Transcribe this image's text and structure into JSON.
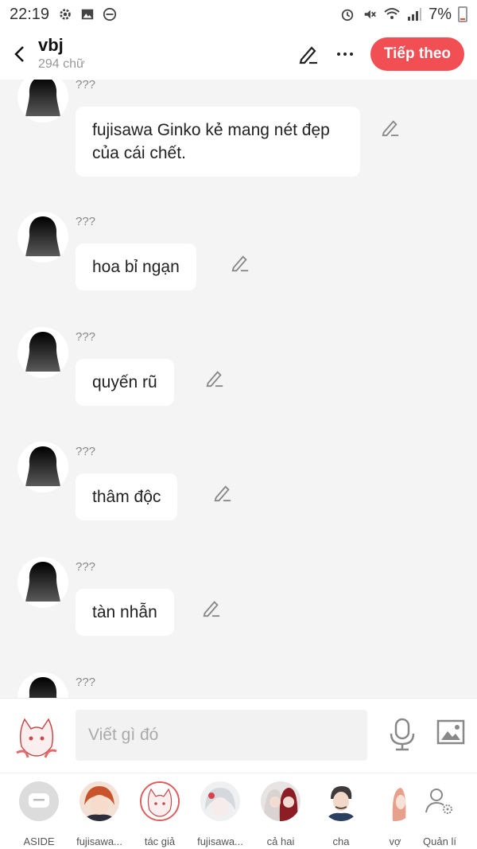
{
  "status_bar": {
    "time": "22:19",
    "battery": "7%"
  },
  "header": {
    "title": "vbj",
    "subtitle": "294 chữ",
    "next_label": "Tiếp theo"
  },
  "messages": [
    {
      "sender": "???",
      "text": "fujisawa Ginko kẻ mang nét đẹp của cái chết."
    },
    {
      "sender": "???",
      "text": "hoa bỉ ngạn"
    },
    {
      "sender": "???",
      "text": "quyến rũ"
    },
    {
      "sender": "???",
      "text": "thâm độc"
    },
    {
      "sender": "???",
      "text": "tàn nhẫn"
    },
    {
      "sender": "???",
      "text": ""
    }
  ],
  "composer": {
    "placeholder": "Viết gì đó"
  },
  "characters": [
    {
      "name": "ASIDE",
      "icon": "chat-bubble-icon"
    },
    {
      "name": "fujisawa...",
      "icon": "avatar"
    },
    {
      "name": "tác giả",
      "icon": "avatar"
    },
    {
      "name": "fujisawa...",
      "icon": "avatar"
    },
    {
      "name": "cả hai",
      "icon": "avatar"
    },
    {
      "name": "cha",
      "icon": "avatar"
    },
    {
      "name": "vợ",
      "icon": "avatar"
    },
    {
      "name": "Quản lí",
      "icon": "user-settings-icon"
    }
  ],
  "colors": {
    "accent": "#f24f55",
    "background": "#f4f4f4"
  }
}
